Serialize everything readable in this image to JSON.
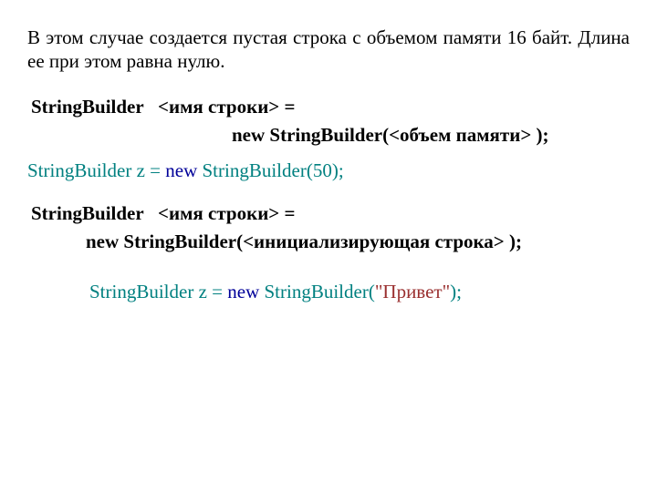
{
  "intro": "В этом случае создается пустая строка с объемом памяти 16 байт. Длина ее при этом равна нулю.",
  "syntax1": {
    "decl": "StringBuilder   <имя строки> =",
    "cons": "new StringBuilder(<объем памяти> );"
  },
  "example1": {
    "part_teal_a": "StringBuilder z = ",
    "part_navy": "new",
    "part_teal_b": " StringBuilder(50);"
  },
  "syntax2": {
    "decl": "StringBuilder   <имя строки> =",
    "cons": "new StringBuilder(<инициализирующая строка> );"
  },
  "example2": {
    "part_teal_a": "StringBuilder z = ",
    "part_navy": "new",
    "part_teal_b": " StringBuilder(",
    "part_maroon": "\"Привет\"",
    "part_teal_c": ");"
  }
}
